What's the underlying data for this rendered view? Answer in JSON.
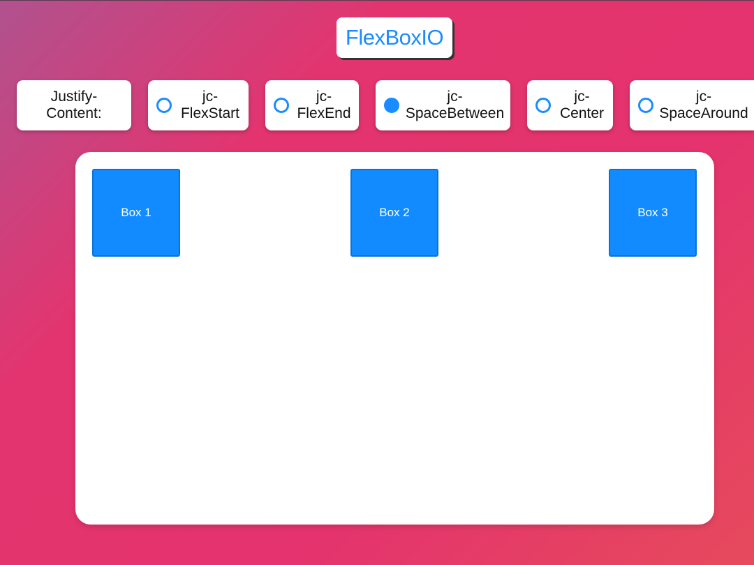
{
  "app": {
    "title": "FlexBoxIO"
  },
  "controls": {
    "group_label": "Justify-\nContent:",
    "options": [
      {
        "label": "jc-\nFlexStart",
        "selected": false
      },
      {
        "label": "jc-\nFlexEnd",
        "selected": false
      },
      {
        "label": "jc-\nSpaceBetween",
        "selected": true
      },
      {
        "label": "jc-\nCenter",
        "selected": false
      },
      {
        "label": "jc-\nSpaceAround",
        "selected": false
      }
    ]
  },
  "boxes": [
    {
      "label": "Box 1"
    },
    {
      "label": "Box 2"
    },
    {
      "label": "Box 3"
    }
  ],
  "colors": {
    "accent": "#1a8cff",
    "box_fill": "#118bff",
    "box_border": "#0b72d4",
    "card": "#ffffff"
  }
}
